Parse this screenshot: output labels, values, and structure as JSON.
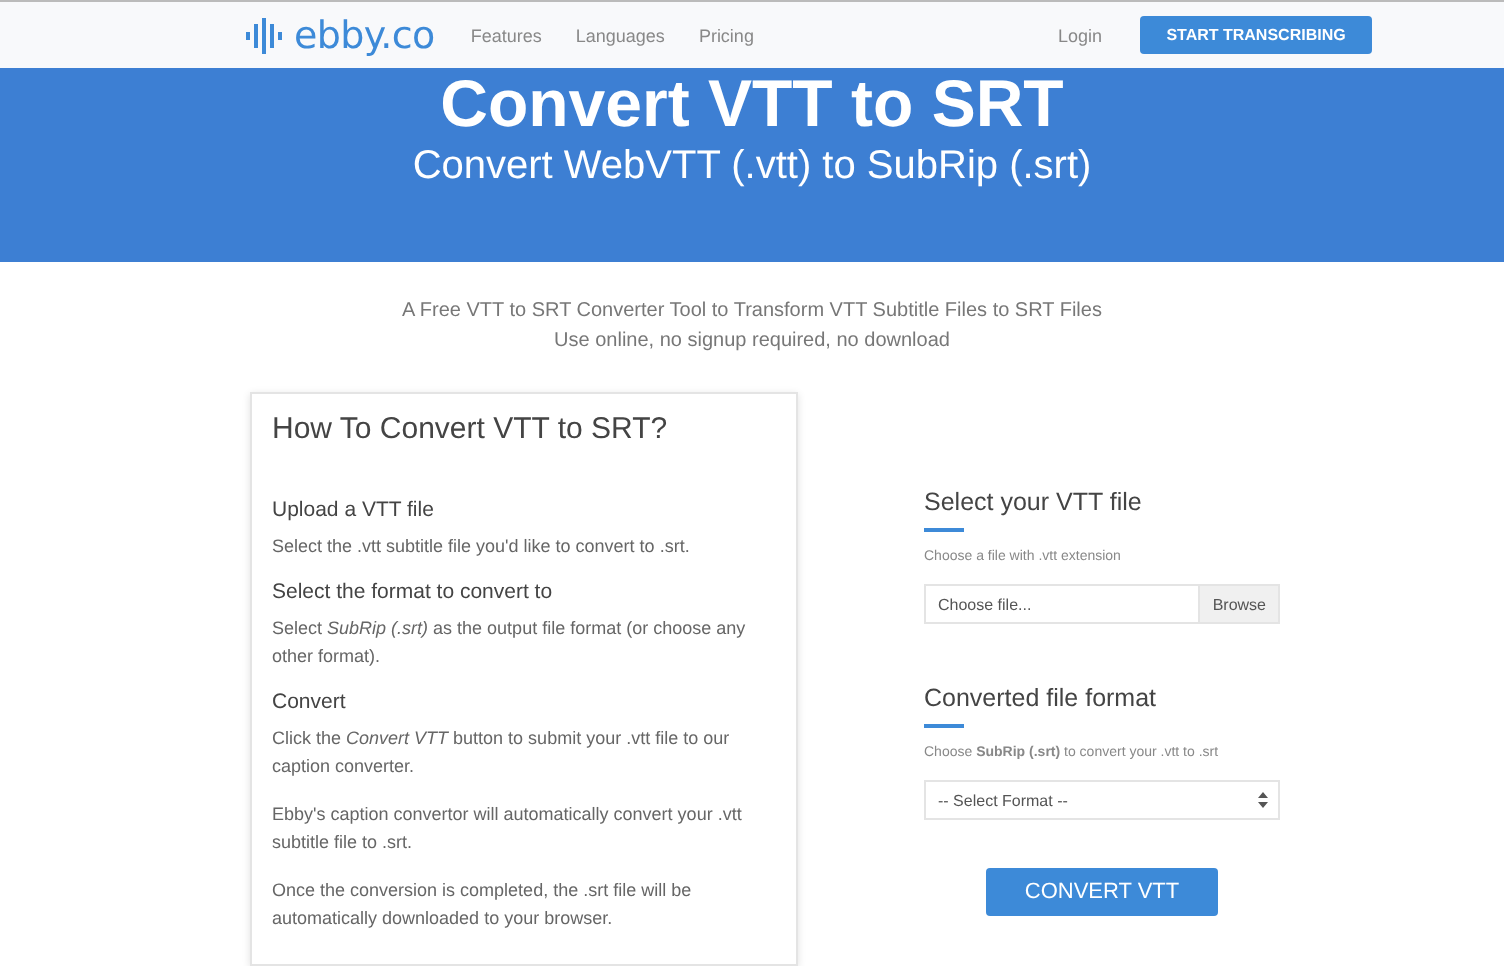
{
  "nav": {
    "logo": "ebby.co",
    "links": [
      {
        "label": "Features"
      },
      {
        "label": "Languages"
      },
      {
        "label": "Pricing"
      }
    ],
    "login": "Login",
    "cta": "START TRANSCRIBING"
  },
  "hero": {
    "title": "Convert VTT to SRT",
    "subtitle": "Convert WebVTT (.vtt) to SubRip (.srt)"
  },
  "intro": [
    "A Free VTT to SRT Converter Tool to Transform VTT Subtitle Files to SRT Files",
    "Use online, no signup required, no download"
  ],
  "howto": {
    "title": "How To Convert VTT to SRT?",
    "steps": [
      {
        "heading": "Upload a VTT file",
        "paragraphs": [
          "Select the .vtt subtitle file you'd like to convert to .srt."
        ]
      },
      {
        "heading": "Select the format to convert to",
        "paragraphs": [
          "Select *SubRip (.srt)* as the output file format (or choose any other format)."
        ]
      },
      {
        "heading": "Convert",
        "paragraphs": [
          "Click the *Convert VTT* button to submit your .vtt file to our caption converter.",
          "Ebby's caption convertor will automatically convert your .vtt subtitle file to .srt.",
          "Once the conversion is completed, the .srt file will be automatically downloaded to your browser."
        ]
      }
    ]
  },
  "form": {
    "file_section": {
      "title": "Select your VTT file",
      "hint": "Choose a file with .vtt extension",
      "placeholder": "Choose file...",
      "browse": "Browse"
    },
    "format_section": {
      "title": "Converted file format",
      "hint": "Choose **SubRip (.srt)** to convert your .vtt to .srt",
      "select": "-- Select Format --"
    },
    "submit": "CONVERT VTT"
  }
}
